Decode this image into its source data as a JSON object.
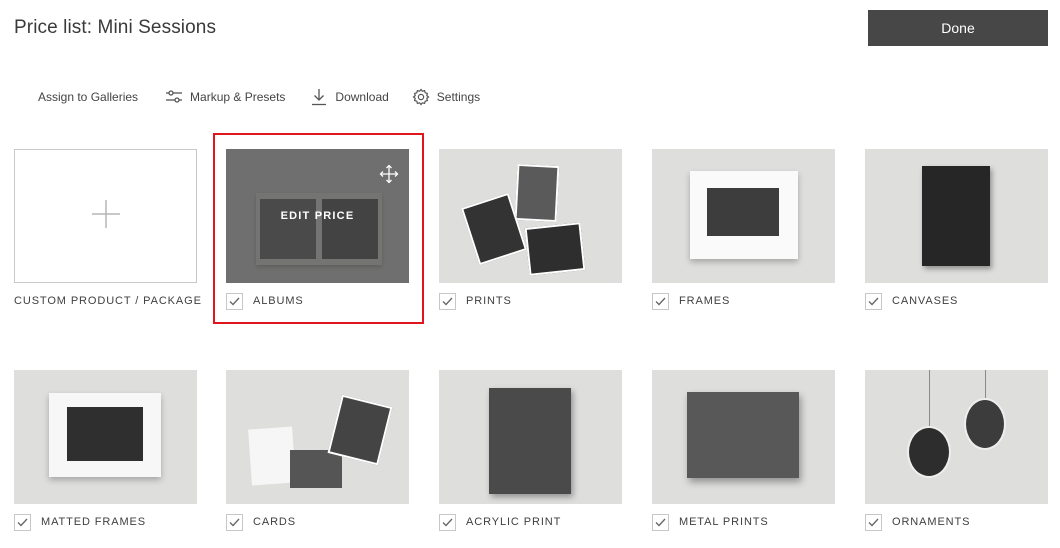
{
  "header": {
    "title": "Price list: Mini Sessions",
    "done_label": "Done"
  },
  "toolbar": {
    "assign": "Assign to Galleries",
    "markup": "Markup & Presets",
    "download": "Download",
    "settings": "Settings"
  },
  "products": {
    "custom": "CUSTOM PRODUCT / PACKAGE",
    "albums": "ALBUMS",
    "prints": "PRINTS",
    "frames": "FRAMES",
    "canvases": "CANVASES",
    "matted_frames": "MATTED FRAMES",
    "cards": "CARDS",
    "acrylic_print": "ACRYLIC PRINT",
    "metal_prints": "METAL PRINTS",
    "ornaments": "ORNAMENTS"
  },
  "albums_overlay": {
    "edit_price": "EDIT PRICE"
  },
  "icons": {
    "plus": "plus-icon",
    "sliders": "sliders-icon",
    "download": "download-icon",
    "settings": "gear-icon",
    "move": "move-icon",
    "check": "check-icon"
  },
  "colors": {
    "accent_selected": "#e0161c",
    "done_button": "#474747",
    "thumb_bg": "#dededd"
  }
}
